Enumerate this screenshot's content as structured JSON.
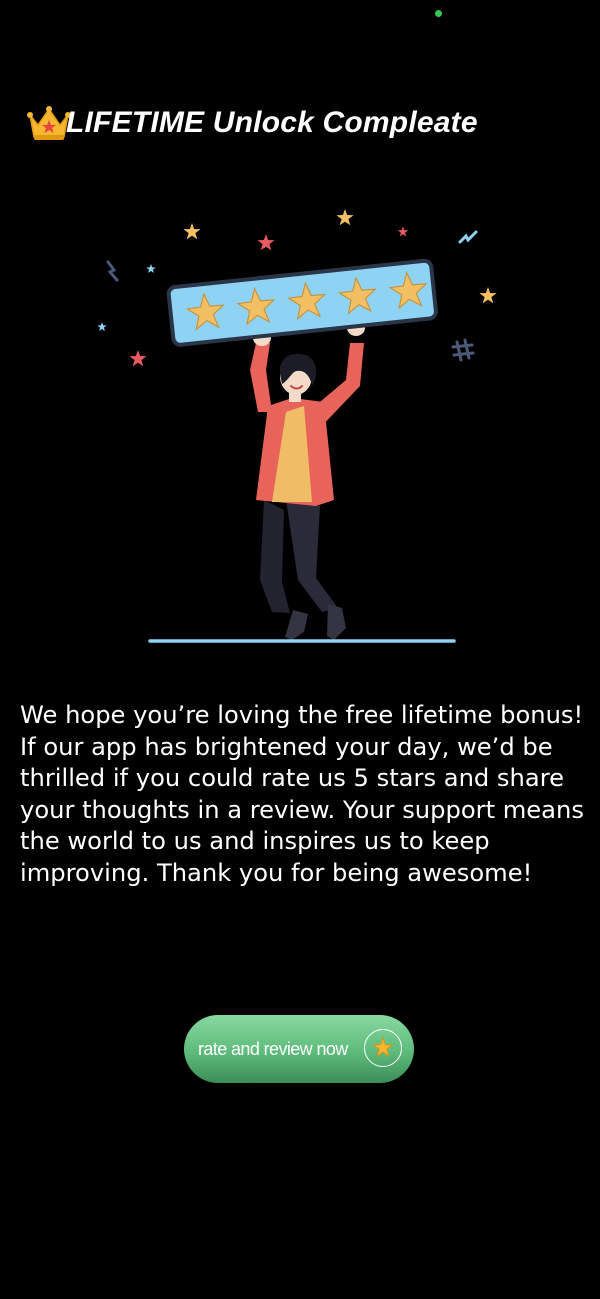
{
  "header": {
    "title": "LIFETIME Unlock Compleate",
    "icon": "crown-icon"
  },
  "illustration": {
    "name": "person-holding-five-star-rating",
    "stars_on_board": 5
  },
  "message": {
    "text": "We hope you’re loving the free lifetime bonus! If our app has brightened your day, we’d be thrilled if you could rate us 5 stars and share your thoughts in a review. Your support means the world to us and inspires us to keep improving. Thank you for being awesome!"
  },
  "cta": {
    "label": "rate and review now",
    "icon": "star-icon"
  },
  "colors": {
    "background": "#000000",
    "text": "#ffffff",
    "cta_green": "#5dbb7a",
    "board_blue": "#8fd3f4",
    "star_gold": "#f2c063",
    "shirt_red": "#e8645a",
    "status_dot": "#34c759"
  }
}
